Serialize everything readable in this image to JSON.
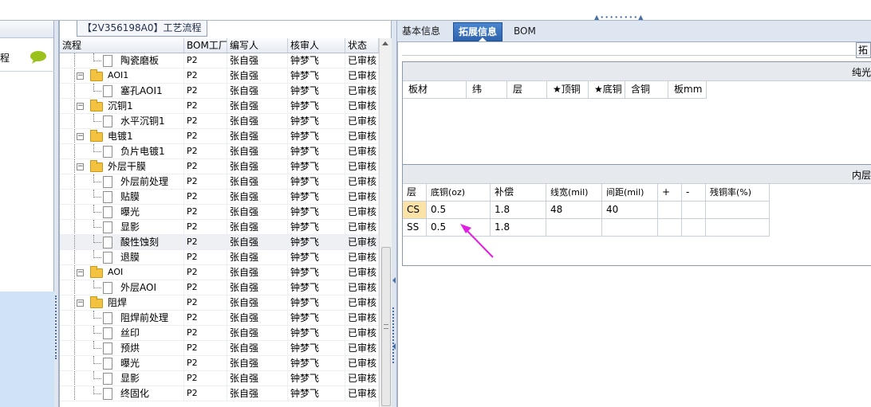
{
  "left_panel": {
    "label_fragment": "程"
  },
  "process_panel": {
    "title": "【2V356198A0】工艺流程",
    "columns": [
      "流程",
      "BOM工厂",
      "编写人",
      "核审人",
      "状态"
    ],
    "rows": [
      {
        "name": "陶瓷磨板",
        "type": "leaf",
        "factory": "P2",
        "writer": "张自强",
        "reviewer": "钟梦飞",
        "status": "已审核"
      },
      {
        "name": "AOI1",
        "type": "folder",
        "factory": "P2",
        "writer": "张自强",
        "reviewer": "钟梦飞",
        "status": "已审核"
      },
      {
        "name": "塞孔AOI1",
        "type": "leaf",
        "factory": "P2",
        "writer": "张自强",
        "reviewer": "钟梦飞",
        "status": "已审核"
      },
      {
        "name": "沉铜1",
        "type": "folder",
        "factory": "P2",
        "writer": "张自强",
        "reviewer": "钟梦飞",
        "status": "已审核"
      },
      {
        "name": "水平沉铜1",
        "type": "leaf",
        "factory": "P2",
        "writer": "张自强",
        "reviewer": "钟梦飞",
        "status": "已审核"
      },
      {
        "name": "电镀1",
        "type": "folder",
        "factory": "P2",
        "writer": "张自强",
        "reviewer": "钟梦飞",
        "status": "已审核"
      },
      {
        "name": "负片电镀1",
        "type": "leaf",
        "factory": "P2",
        "writer": "张自强",
        "reviewer": "钟梦飞",
        "status": "已审核"
      },
      {
        "name": "外层干膜",
        "type": "folder",
        "factory": "P2",
        "writer": "张自强",
        "reviewer": "钟梦飞",
        "status": "已审核"
      },
      {
        "name": "外层前处理",
        "type": "leaf",
        "factory": "P2",
        "writer": "张自强",
        "reviewer": "钟梦飞",
        "status": "已审核"
      },
      {
        "name": "贴膜",
        "type": "leaf",
        "factory": "P2",
        "writer": "张自强",
        "reviewer": "钟梦飞",
        "status": "已审核"
      },
      {
        "name": "曝光",
        "type": "leaf",
        "factory": "P2",
        "writer": "张自强",
        "reviewer": "钟梦飞",
        "status": "已审核"
      },
      {
        "name": "显影",
        "type": "leaf",
        "factory": "P2",
        "writer": "张自强",
        "reviewer": "钟梦飞",
        "status": "已审核"
      },
      {
        "name": "酸性蚀刻",
        "type": "leaf",
        "factory": "P2",
        "writer": "张自强",
        "reviewer": "钟梦飞",
        "status": "已审核",
        "selected": true
      },
      {
        "name": "退膜",
        "type": "leaf",
        "factory": "P2",
        "writer": "张自强",
        "reviewer": "钟梦飞",
        "status": "已审核"
      },
      {
        "name": "AOI",
        "type": "folder",
        "factory": "P2",
        "writer": "张自强",
        "reviewer": "钟梦飞",
        "status": "已审核"
      },
      {
        "name": "外层AOI",
        "type": "leaf",
        "factory": "P2",
        "writer": "张自强",
        "reviewer": "钟梦飞",
        "status": "已审核"
      },
      {
        "name": "阻焊",
        "type": "folder",
        "factory": "P2",
        "writer": "张自强",
        "reviewer": "钟梦飞",
        "status": "已审核"
      },
      {
        "name": "阻焊前处理",
        "type": "leaf",
        "factory": "P2",
        "writer": "张自强",
        "reviewer": "钟梦飞",
        "status": "已审核"
      },
      {
        "name": "丝印",
        "type": "leaf",
        "factory": "P2",
        "writer": "张自强",
        "reviewer": "钟梦飞",
        "status": "已审核"
      },
      {
        "name": "预烘",
        "type": "leaf",
        "factory": "P2",
        "writer": "张自强",
        "reviewer": "钟梦飞",
        "status": "已审核"
      },
      {
        "name": "曝光",
        "type": "leaf",
        "factory": "P2",
        "writer": "张自强",
        "reviewer": "钟梦飞",
        "status": "已审核"
      },
      {
        "name": "显影",
        "type": "leaf",
        "factory": "P2",
        "writer": "张自强",
        "reviewer": "钟梦飞",
        "status": "已审核"
      },
      {
        "name": "终固化",
        "type": "leaf",
        "factory": "P2",
        "writer": "张自强",
        "reviewer": "钟梦飞",
        "status": "已审核"
      }
    ]
  },
  "right_panel": {
    "tabs": [
      {
        "label": "基本信息",
        "active": false
      },
      {
        "label": "拓展信息",
        "active": true
      },
      {
        "label": "BOM",
        "active": false
      }
    ],
    "ext_button_label": "拓",
    "section1": {
      "header": "纯光",
      "columns": [
        "板材",
        "纬",
        "层",
        "★顶铜",
        "★底铜",
        "含铜",
        "板mm"
      ]
    },
    "section2": {
      "header": "内层",
      "columns": [
        "层",
        "底铜(oz)",
        "补偿",
        "线宽(mil)",
        "间距(mil)",
        "+",
        "-",
        "残铜率(%)"
      ],
      "rows": [
        [
          "CS",
          "0.5",
          "1.8",
          "48",
          "40",
          "",
          "",
          ""
        ],
        [
          "SS",
          "0.5",
          "1.8",
          "",
          "",
          "",
          "",
          ""
        ]
      ]
    }
  },
  "colors": {
    "active_tab": "#2e63ad",
    "highlight_cell": "#fbe3a7",
    "annotation_arrow": "#e020e0"
  }
}
